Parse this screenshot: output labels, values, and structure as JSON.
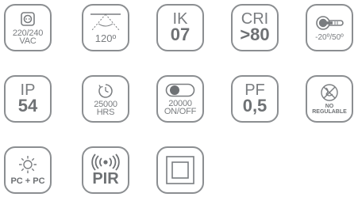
{
  "icons": [
    {
      "id": "voltage",
      "icon": "socket-icon",
      "label": "220/240\nVAC"
    },
    {
      "id": "beam-angle",
      "icon": "beam-angle-icon",
      "label": "120º"
    },
    {
      "id": "ik",
      "top": "IK",
      "bottom": "07"
    },
    {
      "id": "cri",
      "top": "CRI",
      "bottom": ">80"
    },
    {
      "id": "temperature",
      "icon": "thermometer-icon",
      "label": "-20º/50º"
    },
    {
      "id": "ip",
      "top": "IP",
      "bottom": "54"
    },
    {
      "id": "lifetime",
      "icon": "clock-icon",
      "label": "25000\nHRS"
    },
    {
      "id": "switching",
      "icon": "toggle-icon",
      "label": "20000\nON/OFF"
    },
    {
      "id": "power-factor",
      "top": "PF",
      "bottom": "0,5"
    },
    {
      "id": "dimming",
      "icon": "no-dimmer-icon",
      "label": "NO\nREGULABLE"
    },
    {
      "id": "material",
      "icon": "sun-gear-icon",
      "label": "PC + PC"
    },
    {
      "id": "sensor",
      "icon": "signal-waves-icon",
      "label": "PIR"
    },
    {
      "id": "class-ii",
      "icon": "double-square-icon"
    }
  ],
  "colors": {
    "stroke": "#8b8e91",
    "text": "#7a7d80",
    "bold_text": "#6e7174",
    "background": "#ffffff"
  }
}
